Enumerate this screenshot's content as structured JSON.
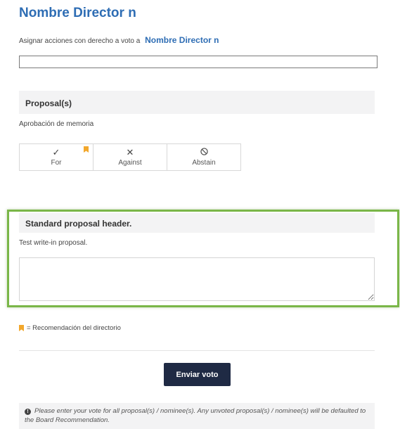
{
  "page": {
    "title": "Nombre Director n"
  },
  "assign": {
    "label": "Asignar acciones con derecho a voto a",
    "director": "Nombre Director n",
    "input_value": ""
  },
  "proposals_section": {
    "header": "Proposal(s)",
    "proposal_text": "Aprobación de memoria",
    "options": [
      {
        "label": "For",
        "icon": "checkmark-icon",
        "recommended": true
      },
      {
        "label": "Against",
        "icon": "x-icon",
        "recommended": false
      },
      {
        "label": "Abstain",
        "icon": "prohibited-icon",
        "recommended": false
      }
    ]
  },
  "standard_section": {
    "header": "Standard proposal header.",
    "proposal_text": "Test write-in proposal.",
    "input_value": ""
  },
  "legend": {
    "text": "= Recomendación del directorio",
    "icon": "bookmark-icon",
    "color": "#f2a72c"
  },
  "submit": {
    "label": "Enviar voto"
  },
  "notice": {
    "icon": "info-icon",
    "text": "Please enter your vote for all proposal(s) / nominee(s). Any unvoted proposal(s) / nominee(s) will be defaulted to the Board Recommendation."
  },
  "colors": {
    "accent": "#2e6db4",
    "button": "#1f2a44",
    "highlight": "#7ab648",
    "bookmark": "#f2a72c"
  }
}
